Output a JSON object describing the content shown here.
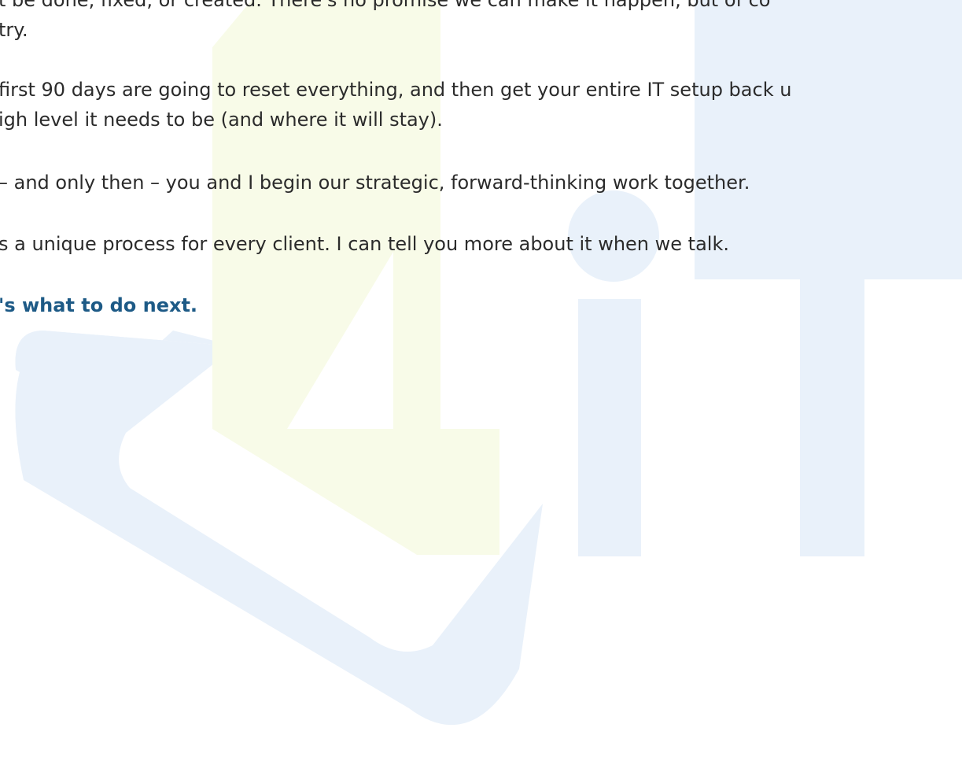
{
  "body": {
    "p1_line1": "t be done, fixed, or created. There's no promise we can make it happen, but of co",
    "p1_line2": "try.",
    "p2_line1": "first 90 days are going to reset everything, and then get your entire IT setup back u",
    "p2_line2": "igh level it needs to be (and where it will stay).",
    "p3": "– and only then – you and I begin our strategic, forward-thinking work together.",
    "p4": "s a unique process for every client. I can tell you more about it when we talk.",
    "cta": "'s what to do next."
  },
  "watermark": {
    "icon": "4it-logo-watermark",
    "colors": {
      "blue": "#e9f1fa",
      "yellow": "#f8fbe8"
    }
  },
  "colors": {
    "text": "#2b2b2b",
    "accent": "#1d5a86",
    "background": "#ffffff"
  }
}
